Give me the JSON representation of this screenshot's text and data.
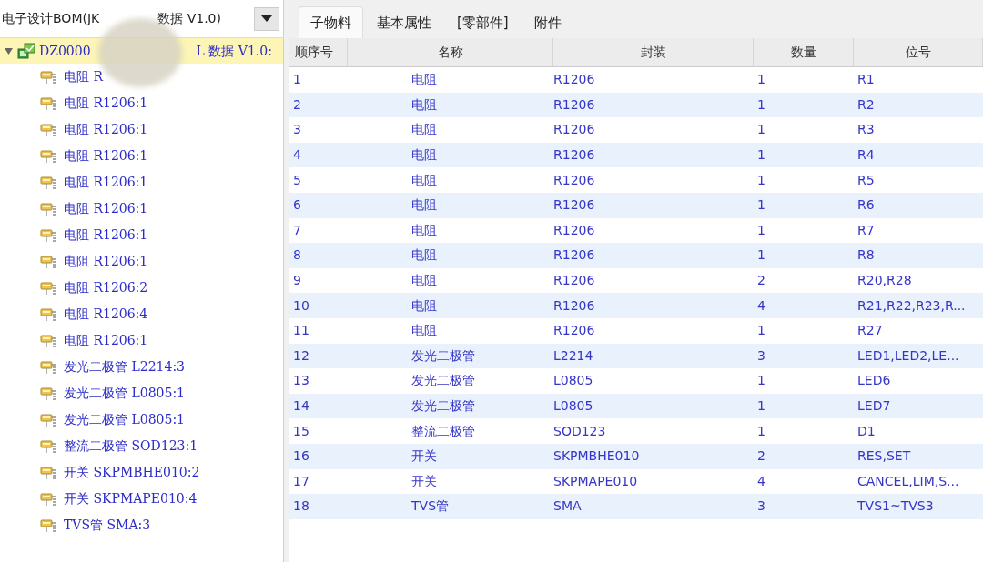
{
  "selector": {
    "text_start": "电子设计BOM(JK",
    "text_end": "数据 V1.0)"
  },
  "tree": {
    "label_start": "DZ0000",
    "label_end": "L 数据 V1.0:",
    "expanded": true,
    "selected": true,
    "children": [
      {
        "label": "电阻 R"
      },
      {
        "label": "电阻 R1206:1"
      },
      {
        "label": "电阻 R1206:1"
      },
      {
        "label": "电阻 R1206:1"
      },
      {
        "label": "电阻 R1206:1"
      },
      {
        "label": "电阻 R1206:1"
      },
      {
        "label": "电阻 R1206:1"
      },
      {
        "label": "电阻 R1206:1"
      },
      {
        "label": "电阻 R1206:2"
      },
      {
        "label": "电阻 R1206:4"
      },
      {
        "label": "电阻 R1206:1"
      },
      {
        "label": "发光二极管 L2214:3"
      },
      {
        "label": "发光二极管 L0805:1"
      },
      {
        "label": "发光二极管 L0805:1"
      },
      {
        "label": "整流二极管 SOD123:1"
      },
      {
        "label": "开关 SKPMBHE010:2"
      },
      {
        "label": "开关 SKPMAPE010:4"
      },
      {
        "label": "TVS管 SMA:3"
      }
    ]
  },
  "tabs": [
    {
      "label": "子物料",
      "selected": true
    },
    {
      "label": "基本属性",
      "selected": false
    },
    {
      "label": "[零部件]",
      "selected": false
    },
    {
      "label": "附件",
      "selected": false
    }
  ],
  "table": {
    "columns": [
      "顺序号",
      "名称",
      "封装",
      "数量",
      "位号"
    ],
    "rows": [
      [
        "1",
        "电阻",
        "R1206",
        "1",
        "R1"
      ],
      [
        "2",
        "电阻",
        "R1206",
        "1",
        "R2"
      ],
      [
        "3",
        "电阻",
        "R1206",
        "1",
        "R3"
      ],
      [
        "4",
        "电阻",
        "R1206",
        "1",
        "R4"
      ],
      [
        "5",
        "电阻",
        "R1206",
        "1",
        "R5"
      ],
      [
        "6",
        "电阻",
        "R1206",
        "1",
        "R6"
      ],
      [
        "7",
        "电阻",
        "R1206",
        "1",
        "R7"
      ],
      [
        "8",
        "电阻",
        "R1206",
        "1",
        "R8"
      ],
      [
        "9",
        "电阻",
        "R1206",
        "2",
        "R20,R28"
      ],
      [
        "10",
        "电阻",
        "R1206",
        "4",
        "R21,R22,R23,R..."
      ],
      [
        "11",
        "电阻",
        "R1206",
        "1",
        "R27"
      ],
      [
        "12",
        "发光二极管",
        "L2214",
        "3",
        "LED1,LED2,LE..."
      ],
      [
        "13",
        "发光二极管",
        "L0805",
        "1",
        "LED6"
      ],
      [
        "14",
        "发光二极管",
        "L0805",
        "1",
        "LED7"
      ],
      [
        "15",
        "整流二极管",
        "SOD123",
        "1",
        "D1"
      ],
      [
        "16",
        "开关",
        "SKPMBHE010",
        "2",
        "RES,SET"
      ],
      [
        "17",
        "开关",
        "SKPMAPE010",
        "4",
        "CANCEL,LIM,S..."
      ],
      [
        "18",
        "TVS管",
        "SMA",
        "3",
        "TVS1~TVS3"
      ]
    ]
  }
}
